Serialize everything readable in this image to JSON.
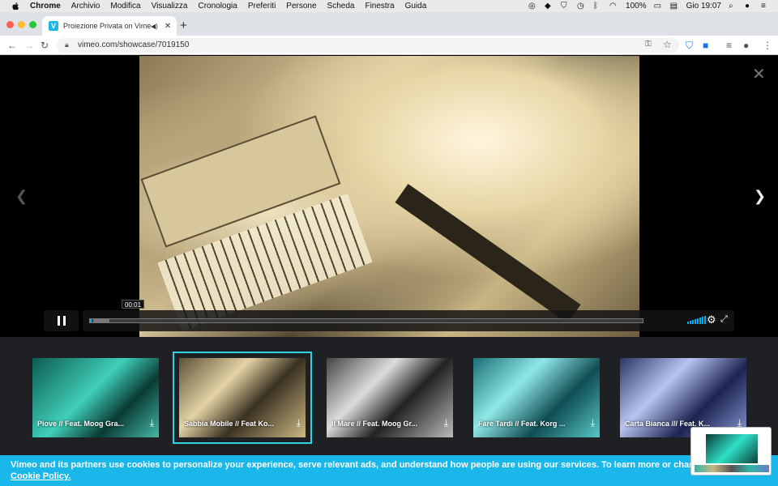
{
  "menubar": {
    "app": "Chrome",
    "items": [
      "Archivio",
      "Modifica",
      "Visualizza",
      "Cronologia",
      "Preferiti",
      "Persone",
      "Scheda",
      "Finestra",
      "Guida"
    ],
    "battery": "100%",
    "clock": "Gio 19:07"
  },
  "browser": {
    "tab_title": "Proiezione Privata on Vime",
    "favicon_letter": "V",
    "url": "vimeo.com/showcase/7019150"
  },
  "player": {
    "current_time": "00:01",
    "progress_fraction": 0.003
  },
  "thumbnails": [
    {
      "label": "Piove // Feat. Moog Gra...",
      "active": false
    },
    {
      "label": "Sabbia Mobile // Feat Ko...",
      "active": true
    },
    {
      "label": "Il Mare // Feat. Moog Gr...",
      "active": false
    },
    {
      "label": "Fare Tardi // Feat. Korg ...",
      "active": false
    },
    {
      "label": "Carta Bianca /// Feat. K...",
      "active": false
    }
  ],
  "cookie": {
    "text": "Vimeo and its partners use cookies to personalize your experience, serve relevant ads, and understand how people are using our services. To learn more or change your p",
    "link": "Cookie Policy."
  },
  "colors": {
    "vimeo_blue": "#1ab7ea",
    "active_outline": "#2dd4e3",
    "progress": "#00adef"
  }
}
